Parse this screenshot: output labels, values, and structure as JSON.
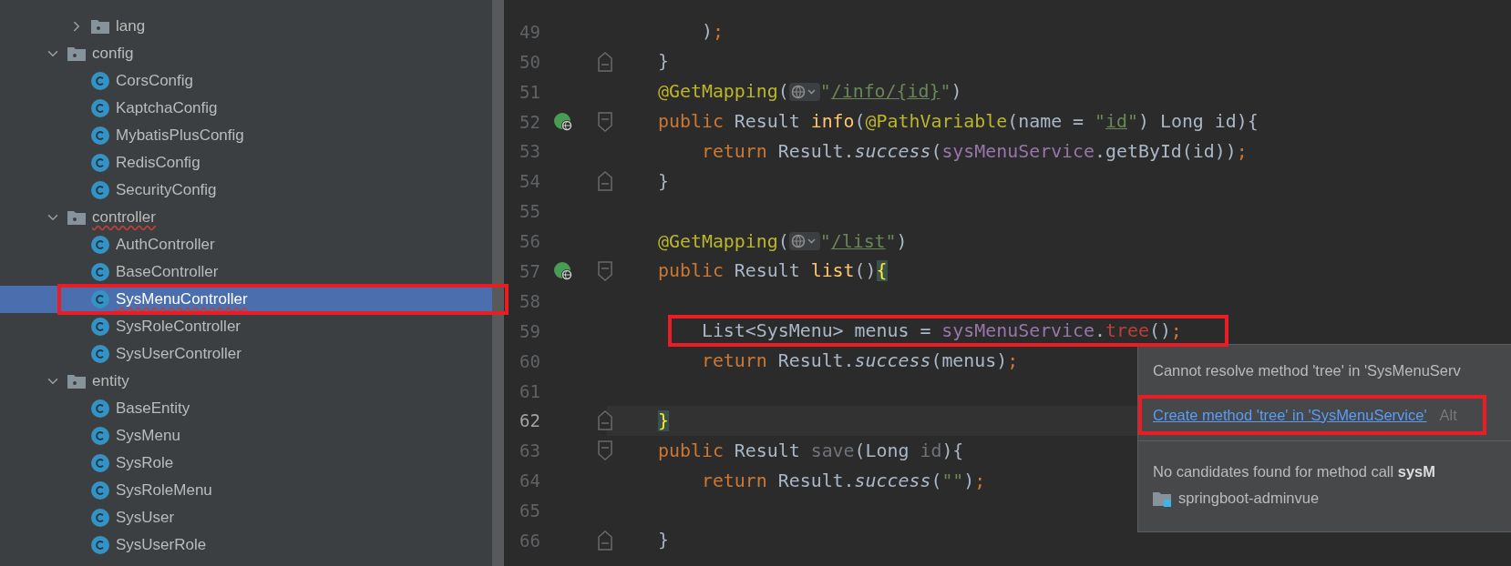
{
  "project_tree": {
    "items": [
      {
        "kind": "group",
        "children": [
          {
            "kind": "package",
            "label": "lang",
            "expanded": false,
            "error": false
          }
        ]
      },
      {
        "kind": "package",
        "label": "config",
        "expanded": true,
        "error": false,
        "children": [
          {
            "kind": "class",
            "label": "CorsConfig",
            "selected": false,
            "error": false,
            "annotated": false
          },
          {
            "kind": "class",
            "label": "KaptchaConfig",
            "selected": false,
            "error": false,
            "annotated": false
          },
          {
            "kind": "class",
            "label": "MybatisPlusConfig",
            "selected": false,
            "error": false,
            "annotated": false
          },
          {
            "kind": "class",
            "label": "RedisConfig",
            "selected": false,
            "error": false,
            "annotated": false
          },
          {
            "kind": "class",
            "label": "SecurityConfig",
            "selected": false,
            "error": false,
            "annotated": false
          }
        ]
      },
      {
        "kind": "package",
        "label": "controller",
        "expanded": true,
        "error": true,
        "children": [
          {
            "kind": "class",
            "label": "AuthController",
            "selected": false,
            "error": false,
            "annotated": false
          },
          {
            "kind": "class",
            "label": "BaseController",
            "selected": false,
            "error": false,
            "annotated": false
          },
          {
            "kind": "class",
            "label": "SysMenuController",
            "selected": true,
            "error": true,
            "annotated": true
          },
          {
            "kind": "class",
            "label": "SysRoleController",
            "selected": false,
            "error": false,
            "annotated": false
          },
          {
            "kind": "class",
            "label": "SysUserController",
            "selected": false,
            "error": false,
            "annotated": false
          }
        ]
      },
      {
        "kind": "package",
        "label": "entity",
        "expanded": true,
        "error": false,
        "children": [
          {
            "kind": "class",
            "label": "BaseEntity",
            "selected": false,
            "error": false,
            "annotated": false
          },
          {
            "kind": "class",
            "label": "SysMenu",
            "selected": false,
            "error": false,
            "annotated": false
          },
          {
            "kind": "class",
            "label": "SysRole",
            "selected": false,
            "error": false,
            "annotated": false
          },
          {
            "kind": "class",
            "label": "SysRoleMenu",
            "selected": false,
            "error": false,
            "annotated": false
          },
          {
            "kind": "class",
            "label": "SysUser",
            "selected": false,
            "error": false,
            "annotated": false
          },
          {
            "kind": "class",
            "label": "SysUserRole",
            "selected": false,
            "error": false,
            "annotated": false
          }
        ]
      }
    ]
  },
  "editor": {
    "lines": [
      {
        "number": "49",
        "gutter_icon": false,
        "fold_start": false,
        "fold_end": false,
        "current": false,
        "annotated": false,
        "tokens": [
          {
            "kind": "plain",
            "text": "    )"
          },
          {
            "kind": "semi",
            "text": ";"
          }
        ]
      },
      {
        "number": "50",
        "gutter_icon": false,
        "fold_start": false,
        "fold_end": true,
        "current": false,
        "annotated": false,
        "tokens": [
          {
            "kind": "plain",
            "text": "}"
          }
        ]
      },
      {
        "number": "51",
        "gutter_icon": false,
        "fold_start": false,
        "fold_end": false,
        "current": false,
        "annotated": false,
        "tokens": [
          {
            "kind": "annotation",
            "text": "@GetMapping"
          },
          {
            "kind": "plain",
            "text": "("
          },
          {
            "kind": "globe"
          },
          {
            "kind": "string",
            "text": "\""
          },
          {
            "kind": "url",
            "text": "/info/{id}"
          },
          {
            "kind": "string",
            "text": "\""
          },
          {
            "kind": "plain",
            "text": ")"
          }
        ]
      },
      {
        "number": "52",
        "gutter_icon": true,
        "fold_start": true,
        "fold_end": false,
        "current": false,
        "annotated": false,
        "tokens": [
          {
            "kind": "keyword",
            "text": "public"
          },
          {
            "kind": "plain",
            "text": " Result "
          },
          {
            "kind": "method",
            "text": "info"
          },
          {
            "kind": "plain",
            "text": "("
          },
          {
            "kind": "annotation",
            "text": "@PathVariable"
          },
          {
            "kind": "plain",
            "text": "(name = "
          },
          {
            "kind": "string",
            "text": "\""
          },
          {
            "kind": "url",
            "text": "id"
          },
          {
            "kind": "string",
            "text": "\""
          },
          {
            "kind": "plain",
            "text": ") Long id){"
          }
        ]
      },
      {
        "number": "53",
        "gutter_icon": false,
        "fold_start": false,
        "fold_end": false,
        "current": false,
        "annotated": false,
        "tokens": [
          {
            "kind": "keyword",
            "text": "    return"
          },
          {
            "kind": "plain",
            "text": " Result."
          },
          {
            "kind": "call",
            "text": "success"
          },
          {
            "kind": "plain",
            "text": "("
          },
          {
            "kind": "field",
            "text": "sysMenuService"
          },
          {
            "kind": "plain",
            "text": ".getById(id))"
          },
          {
            "kind": "semi",
            "text": ";"
          }
        ]
      },
      {
        "number": "54",
        "gutter_icon": false,
        "fold_start": false,
        "fold_end": true,
        "current": false,
        "annotated": false,
        "tokens": [
          {
            "kind": "plain",
            "text": "}"
          }
        ]
      },
      {
        "number": "55",
        "gutter_icon": false,
        "fold_start": false,
        "fold_end": false,
        "current": false,
        "annotated": false
      },
      {
        "number": "56",
        "gutter_icon": false,
        "fold_start": false,
        "fold_end": false,
        "current": false,
        "annotated": false,
        "tokens": [
          {
            "kind": "annotation",
            "text": "@GetMapping"
          },
          {
            "kind": "plain",
            "text": "("
          },
          {
            "kind": "globe"
          },
          {
            "kind": "string",
            "text": "\""
          },
          {
            "kind": "url",
            "text": "/list"
          },
          {
            "kind": "string",
            "text": "\""
          },
          {
            "kind": "plain",
            "text": ")"
          }
        ]
      },
      {
        "number": "57",
        "gutter_icon": true,
        "fold_start": true,
        "fold_end": false,
        "current": false,
        "annotated": false,
        "tokens": [
          {
            "kind": "keyword",
            "text": "public"
          },
          {
            "kind": "plain",
            "text": " Result "
          },
          {
            "kind": "method",
            "text": "list"
          },
          {
            "kind": "plain",
            "text": "()"
          },
          {
            "kind": "brace",
            "text": "{"
          }
        ]
      },
      {
        "number": "58",
        "gutter_icon": false,
        "fold_start": false,
        "fold_end": false,
        "current": false,
        "annotated": false
      },
      {
        "number": "59",
        "gutter_icon": false,
        "fold_start": false,
        "fold_end": false,
        "current": false,
        "annotated": true,
        "tokens": [
          {
            "kind": "plain",
            "text": "    List<SysMenu> menus = "
          },
          {
            "kind": "field",
            "text": "sysMenuService"
          },
          {
            "kind": "plain",
            "text": "."
          },
          {
            "kind": "error",
            "text": "tree"
          },
          {
            "kind": "plain",
            "text": "()"
          },
          {
            "kind": "semi",
            "text": ";"
          }
        ]
      },
      {
        "number": "60",
        "gutter_icon": false,
        "fold_start": false,
        "fold_end": false,
        "current": false,
        "annotated": false,
        "tokens": [
          {
            "kind": "keyword",
            "text": "    return"
          },
          {
            "kind": "plain",
            "text": " Result."
          },
          {
            "kind": "call",
            "text": "success"
          },
          {
            "kind": "plain",
            "text": "(menus)"
          },
          {
            "kind": "semi",
            "text": ";"
          }
        ]
      },
      {
        "number": "61",
        "gutter_icon": false,
        "fold_start": false,
        "fold_end": false,
        "current": false,
        "annotated": false
      },
      {
        "number": "62",
        "gutter_icon": false,
        "fold_start": false,
        "fold_end": true,
        "current": true,
        "annotated": false,
        "tokens": [
          {
            "kind": "brace",
            "text": "}"
          }
        ]
      },
      {
        "number": "63",
        "gutter_icon": false,
        "fold_start": true,
        "fold_end": false,
        "current": false,
        "annotated": false,
        "tokens": [
          {
            "kind": "keyword",
            "text": "public"
          },
          {
            "kind": "plain",
            "text": " Result "
          },
          {
            "kind": "unused",
            "text": "save"
          },
          {
            "kind": "plain",
            "text": "(Long "
          },
          {
            "kind": "unused",
            "text": "id"
          },
          {
            "kind": "plain",
            "text": "){"
          }
        ]
      },
      {
        "number": "64",
        "gutter_icon": false,
        "fold_start": false,
        "fold_end": false,
        "current": false,
        "annotated": false,
        "tokens": [
          {
            "kind": "keyword",
            "text": "    return"
          },
          {
            "kind": "plain",
            "text": " Result."
          },
          {
            "kind": "call",
            "text": "success"
          },
          {
            "kind": "plain",
            "text": "("
          },
          {
            "kind": "string",
            "text": "\"\""
          },
          {
            "kind": "plain",
            "text": ")"
          },
          {
            "kind": "semi",
            "text": ";"
          }
        ]
      },
      {
        "number": "65",
        "gutter_icon": false,
        "fold_start": false,
        "fold_end": false,
        "current": false,
        "annotated": false
      },
      {
        "number": "66",
        "gutter_icon": false,
        "fold_start": false,
        "fold_end": true,
        "current": false,
        "annotated": false,
        "tokens": [
          {
            "kind": "plain",
            "text": "}"
          }
        ]
      }
    ]
  },
  "popup": {
    "message": "Cannot resolve method 'tree' in 'SysMenuServ",
    "action": {
      "label": "Create method 'tree' in 'SysMenuService'",
      "annotated": true
    },
    "shortcut": "Alt",
    "detail": "No candidates found for method call **sysM**",
    "module": "springboot-adminvue"
  }
}
